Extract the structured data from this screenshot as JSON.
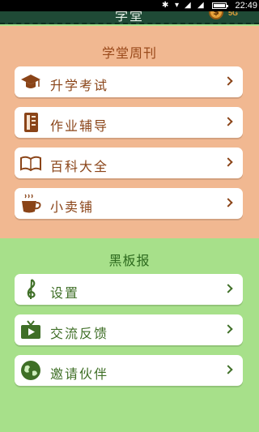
{
  "status": {
    "time": "22:49",
    "bluetooth_icon": "bluetooth-icon",
    "wifi_icon": "wifi-icon",
    "battery_icon": "battery-icon"
  },
  "topbar": {
    "title": "学堂",
    "coin_symbol": "$",
    "network": "5G"
  },
  "section1": {
    "title": "学堂周刊",
    "items": [
      {
        "label": "升学考试",
        "icon": "graduation-cap-icon"
      },
      {
        "label": "作业辅导",
        "icon": "notebook-icon"
      },
      {
        "label": "百科大全",
        "icon": "open-book-icon"
      },
      {
        "label": "小卖铺",
        "icon": "cup-icon"
      }
    ]
  },
  "section2": {
    "title": "黑板报",
    "items": [
      {
        "label": "设置",
        "icon": "music-note-icon"
      },
      {
        "label": "交流反馈",
        "icon": "tv-icon"
      },
      {
        "label": "邀请伙伴",
        "icon": "globe-icon"
      }
    ]
  },
  "colors": {
    "header_bg": "#1f4a36",
    "section1_bg": "#f1b891",
    "section2_bg": "#a7e08a",
    "section1_text": "#8a4418",
    "section2_text": "#3f6f27"
  }
}
